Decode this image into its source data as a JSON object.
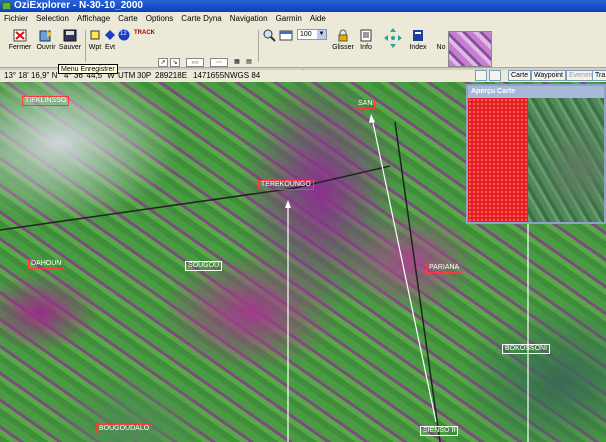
{
  "window": {
    "title": "OziExplorer - N-30-10_2000"
  },
  "menu": [
    "Fichier",
    "Selection",
    "Affichage",
    "Carte",
    "Options",
    "Carte Dyna",
    "Navigation",
    "Garmin",
    "Aide"
  ],
  "toolbar": {
    "close_label": "Fermer",
    "open_label": "Ouvrir",
    "save_label": "Sauver",
    "wpt_label": "Wpt",
    "evt_label": "Evt",
    "track_label": "TRACK",
    "badge_number": "12",
    "zoom_value": "100",
    "pan_label": "Glisser",
    "info_label": "Info",
    "index_label": "Index",
    "nord_label": "No"
  },
  "tooltip": "Menu Enregistrer",
  "status": {
    "lat_lon": "13° 18' 16,9\" N",
    "lon_partial": "4° 36' 44,5\" W",
    "utm_label": "UTM",
    "zone": "30P",
    "easting": "289218E",
    "northing": "1471655N",
    "datum": "WGS 84",
    "carte_btn": "Carte",
    "waypoint_btn": "Waypoint",
    "evenement_btn": "Evenement",
    "tra_btn": "Tra"
  },
  "overview": {
    "title": "Aperçu Carte"
  },
  "places": {
    "tieklinsso": "TIEKLINSSO",
    "san": "SAN",
    "terekoungo": "TEREKOUNGO",
    "dahoun": "DAHOUN",
    "sougou": "SOUGOU",
    "pariana": "PARIANA",
    "bokossoni": "BOKOSSONI",
    "bougoudalo": "BOUGOUDALO",
    "sienso": "SIENSO II"
  }
}
